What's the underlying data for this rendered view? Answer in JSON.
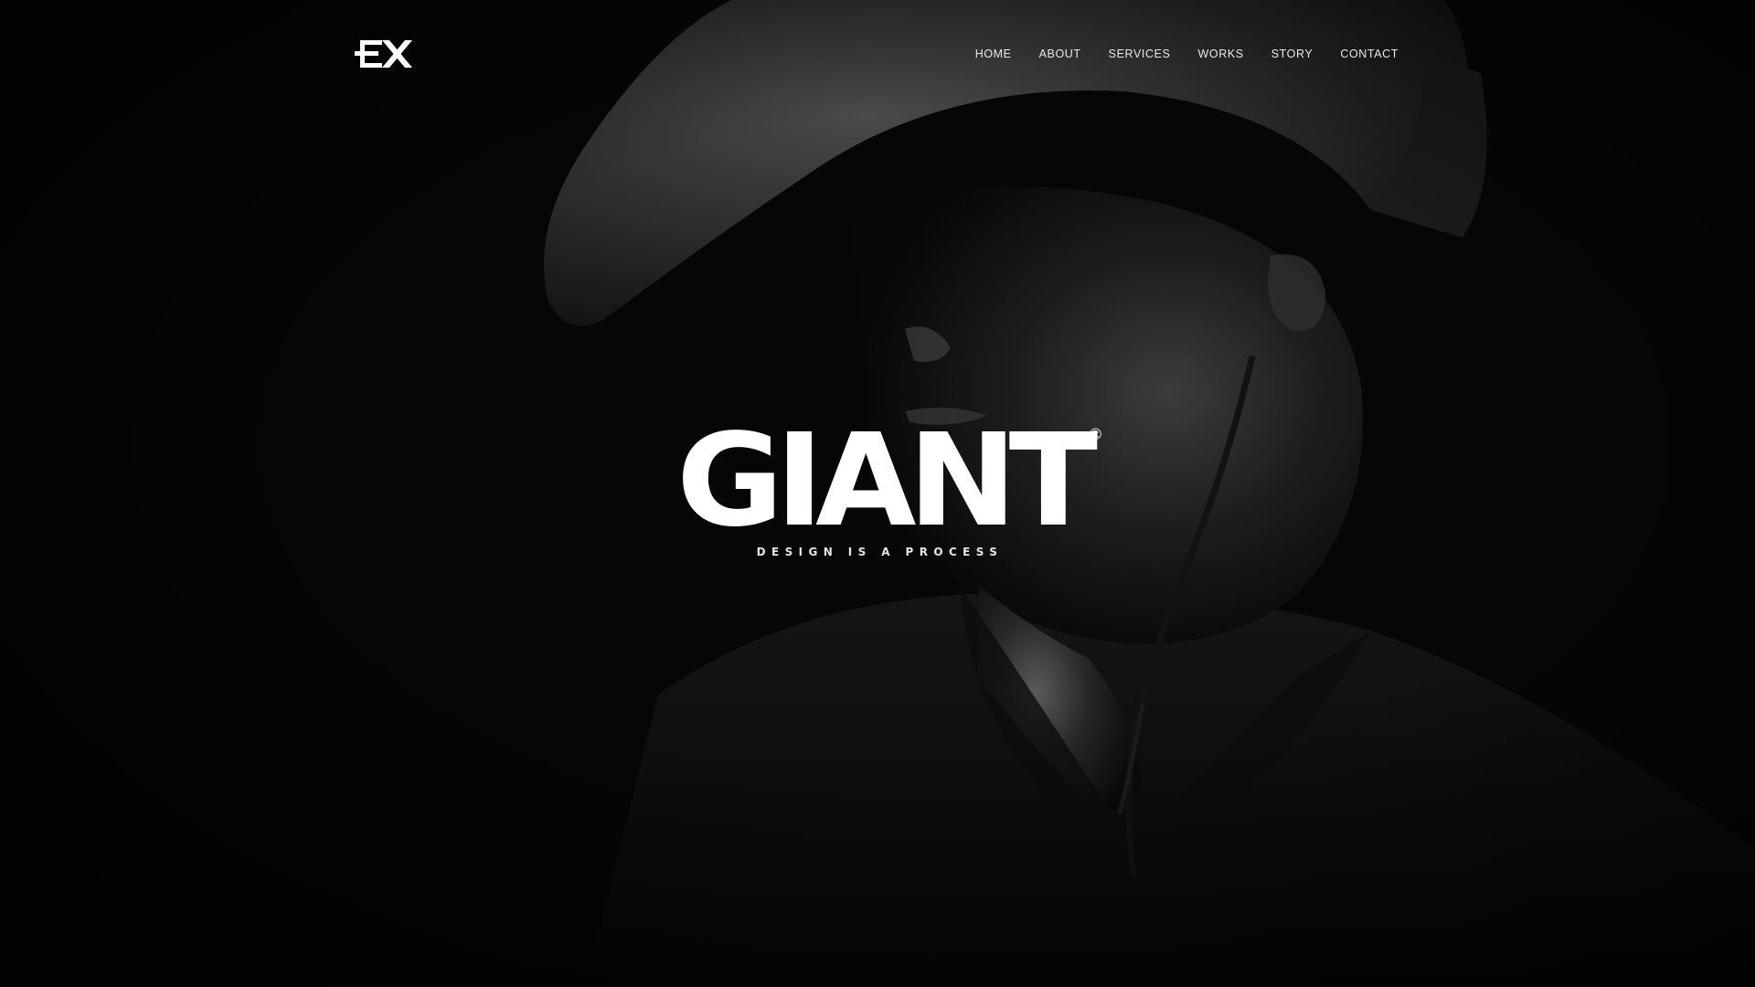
{
  "brand": {
    "logo_text": "EX",
    "icon": "ex-logo-icon"
  },
  "nav": {
    "items": [
      {
        "label": "HOME"
      },
      {
        "label": "ABOUT"
      },
      {
        "label": "SERVICES"
      },
      {
        "label": "WORKS"
      },
      {
        "label": "STORY"
      },
      {
        "label": "CONTACT"
      }
    ]
  },
  "hero": {
    "title": "GIANT",
    "registered_mark": "®",
    "tagline": "DESIGN IS A PROCESS",
    "background_image": "black-and-white-portrait-of-person-in-wide-brim-hat"
  },
  "colors": {
    "background": "#050505",
    "text": "#ffffff",
    "nav_text": "#e9e9e9"
  }
}
